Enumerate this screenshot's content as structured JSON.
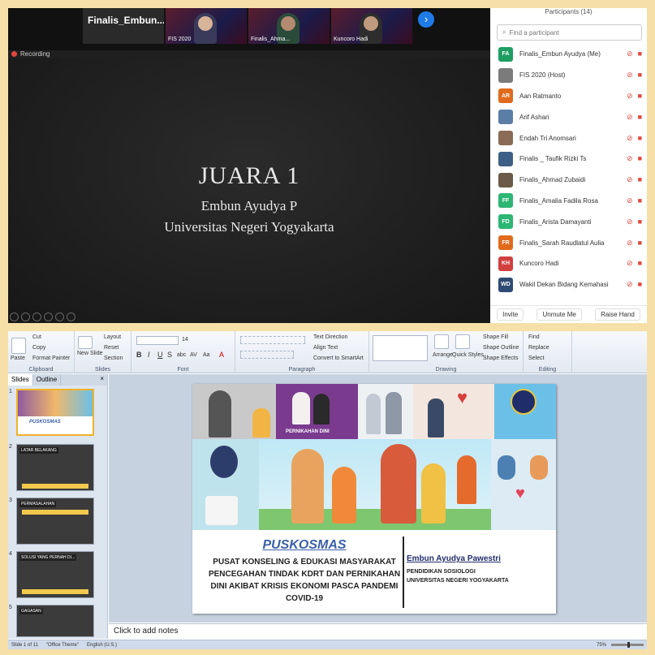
{
  "zoom": {
    "meeting_name": "Finalis_Embun...",
    "video_tiles": [
      {
        "name": "FIS 2020"
      },
      {
        "name": "Finalis_Ahma..."
      },
      {
        "name": "Kuncoro Hadi"
      }
    ],
    "next_arrow": "›",
    "recording_label": "Recording",
    "share": {
      "line1": "JUARA 1",
      "line2": "Embun Ayudya P",
      "line3": "Universitas Negeri Yogyakarta"
    },
    "participants": {
      "header": "Participants (14)",
      "search_placeholder": "Find a participant",
      "list": [
        {
          "initials": "FA",
          "name": "Finalis_Embun Ayudya (Me)",
          "color": "#1e9e63"
        },
        {
          "initials": "",
          "name": "FIS 2020 (Host)",
          "color": "#7b7b7b"
        },
        {
          "initials": "AR",
          "name": "Aan Ratmanto",
          "color": "#e06b1d"
        },
        {
          "initials": "",
          "name": "Arif Ashari",
          "color": "#5b7ea6"
        },
        {
          "initials": "",
          "name": "Endah Tri Anomsari",
          "color": "#8a6b55"
        },
        {
          "initials": "",
          "name": "Finalis _ Taufik Rizki Ts",
          "color": "#3e5f85"
        },
        {
          "initials": "",
          "name": "Finalis_Ahmad Zubaidi",
          "color": "#6a5a47"
        },
        {
          "initials": "FF",
          "name": "Finalis_Amalia Fadila Rosa",
          "color": "#2bb673"
        },
        {
          "initials": "FD",
          "name": "Finalis_Arista Damayanti",
          "color": "#2bb673"
        },
        {
          "initials": "FR",
          "name": "Finalis_Sarah Raudlatul Aulia",
          "color": "#e06b1d"
        },
        {
          "initials": "KH",
          "name": "Kuncoro Hadi",
          "color": "#d23f3f"
        },
        {
          "initials": "WD",
          "name": "Wakil Dekan Bidang Kemahasis...",
          "color": "#2e4b73"
        }
      ],
      "footer": {
        "invite": "Invite",
        "unmute": "Unmute Me",
        "raise": "Raise Hand"
      }
    }
  },
  "ppt": {
    "ribbon": {
      "clipboard": {
        "label": "Clipboard",
        "paste": "Paste",
        "cut": "Cut",
        "copy": "Copy",
        "format_painter": "Format Painter"
      },
      "slides": {
        "label": "Slides",
        "new_slide": "New Slide",
        "layout": "Layout",
        "reset": "Reset",
        "section": "Section"
      },
      "font": {
        "label": "Font",
        "size": "14",
        "bold": "B",
        "italic": "I",
        "underline": "U",
        "strike": "S",
        "abc": "abc",
        "av": "AV",
        "aa": "Aa",
        "a": "A"
      },
      "paragraph": {
        "label": "Paragraph",
        "text_direction": "Text Direction",
        "align_text": "Align Text",
        "convert": "Convert to SmartArt"
      },
      "drawing": {
        "label": "Drawing",
        "arrange": "Arrange",
        "quick_styles": "Quick Styles",
        "shape_fill": "Shape Fill",
        "shape_outline": "Shape Outline",
        "shape_effects": "Shape Effects"
      },
      "editing": {
        "label": "Editing",
        "find": "Find",
        "replace": "Replace",
        "select": "Select"
      }
    },
    "panel": {
      "tab_slides": "Slides",
      "tab_outline": "Outline",
      "close": "×",
      "thumbs": [
        {
          "num": "1",
          "title": "PUSKOSMAS"
        },
        {
          "num": "2",
          "title": "LATAR BELAKANG"
        },
        {
          "num": "3",
          "title": "PERMASALAHAN"
        },
        {
          "num": "4",
          "title": "SOLUSI YANG PERNAH DI..."
        },
        {
          "num": "5",
          "title": "GAGASAN"
        }
      ]
    },
    "slide": {
      "pernikahan_label": "PERNIKAHAN DINI",
      "title": "PUSKOSMAS",
      "subtitle_lines": [
        "PUSAT KONSELING & EDUKASI MASYARAKAT",
        "PENCEGAHAN TINDAK KDRT DAN PERNIKAHAN",
        "DINI AKIBAT KRISIS EKONOMI PASCA PANDEMI",
        "COVID-19"
      ],
      "author": "Embun Ayudya Pawestri",
      "dept1": "PENDIDIKAN SOSIOLOGI",
      "dept2": "UNIVERSITAS NEGERI YOGYAKARTA"
    },
    "notes_placeholder": "Click to add notes",
    "status": {
      "slide": "Slide 1 of 11",
      "theme": "\"Office Theme\"",
      "language": "English (U.S.)",
      "zoom": "75%"
    }
  }
}
